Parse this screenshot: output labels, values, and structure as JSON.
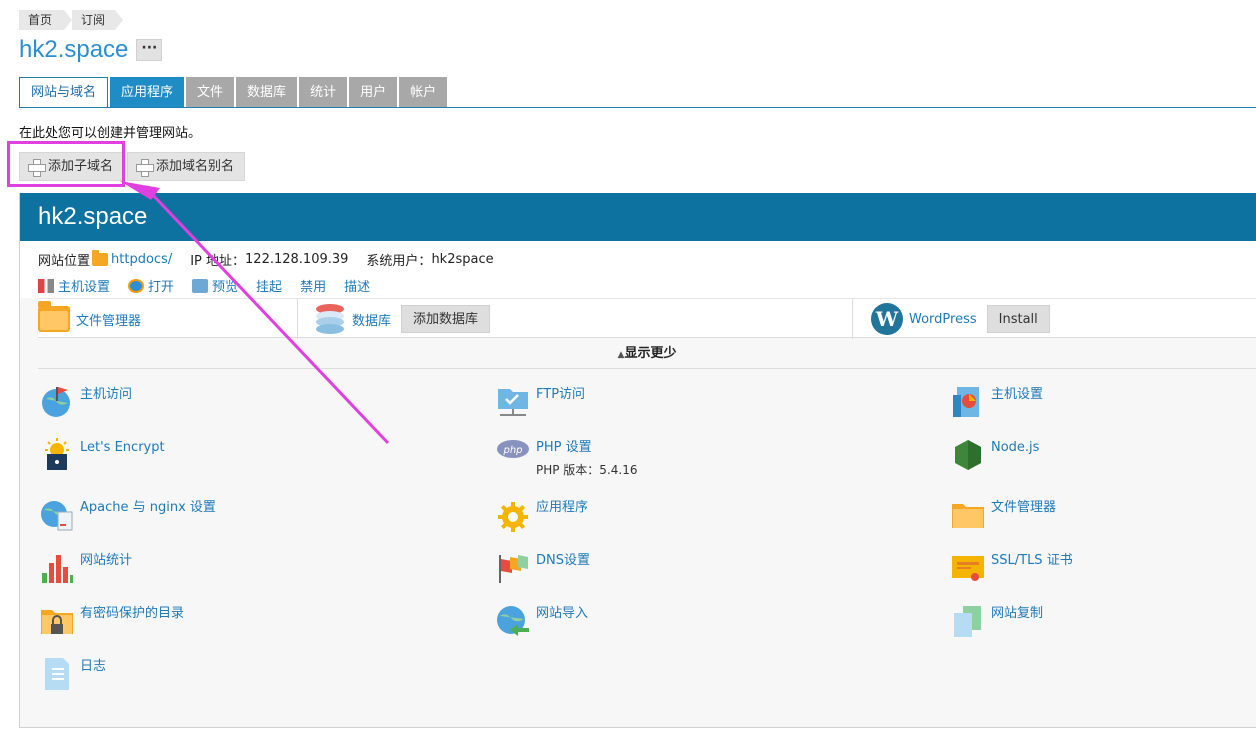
{
  "breadcrumb": [
    "首页",
    "订阅"
  ],
  "site_title": "hk2.space",
  "more_label": "···",
  "tabs": [
    "网站与域名",
    "应用程序",
    "文件",
    "数据库",
    "统计",
    "用户",
    "帐户"
  ],
  "description": "在此处您可以创建并管理网站。",
  "actions": {
    "add_subdomain": "添加子域名",
    "add_alias": "添加域名别名"
  },
  "panel": {
    "domain": "hk2.space",
    "location_label": "网站位置",
    "location_link": "httpdocs/",
    "ip_label": "IP 地址：",
    "ip_value": "122.128.109.39",
    "sysuser_label": "系统用户：",
    "sysuser_value": "hk2space",
    "hosting_links": [
      "主机设置",
      "打开",
      "预览",
      "挂起",
      "禁用",
      "描述"
    ],
    "file_manager": "文件管理器",
    "database": "数据库",
    "add_database": "添加数据库",
    "wordpress": "WordPress",
    "install": "Install",
    "show_less": "显示更少"
  },
  "tools": [
    {
      "label": "主机访问"
    },
    {
      "label": "FTP访问"
    },
    {
      "label": "主机设置"
    },
    {
      "label": "Let's Encrypt"
    },
    {
      "label": "PHP 设置",
      "sub": "PHP 版本：5.4.16"
    },
    {
      "label": "Node.js"
    },
    {
      "label": "Apache 与 nginx 设置"
    },
    {
      "label": "应用程序"
    },
    {
      "label": "文件管理器"
    },
    {
      "label": "网站统计"
    },
    {
      "label": "DNS设置"
    },
    {
      "label": "SSL/TLS 证书"
    },
    {
      "label": "有密码保护的目录"
    },
    {
      "label": "网站导入"
    },
    {
      "label": "网站复制"
    },
    {
      "label": "日志"
    }
  ],
  "colors": {
    "accent": "#0d72a0",
    "link": "#1e7ab8",
    "annotation": "#e040e0"
  }
}
